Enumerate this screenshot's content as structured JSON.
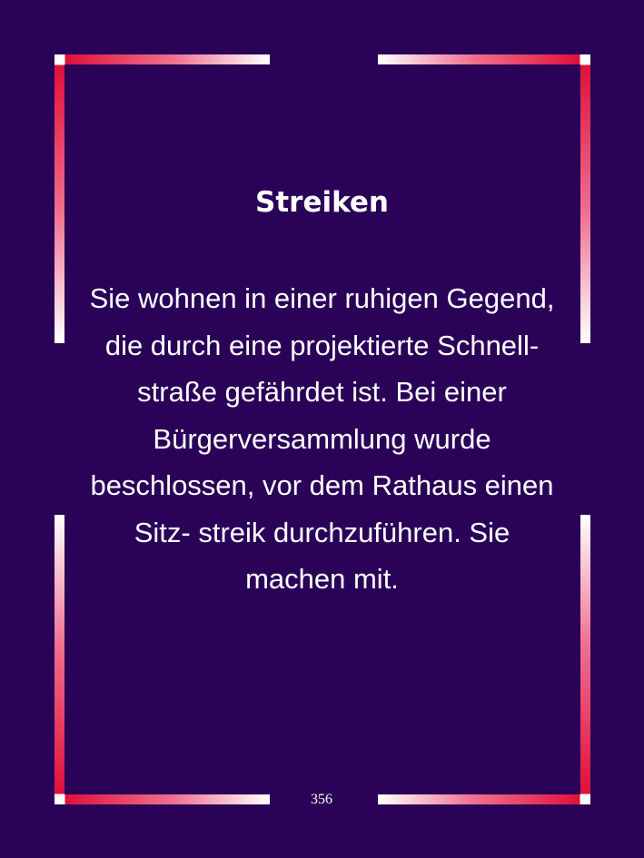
{
  "card": {
    "title": "Streiken",
    "body": "Sie wohnen in einer ruhigen Gegend, die durch eine projektierte Schnell- straße gefährdet ist. Bei einer Bürgerversammlung wurde beschlossen, vor dem Rathaus einen Sitz- streik durchzuführen. Sie machen mit.",
    "page_number": "356"
  },
  "colors": {
    "background": "#2a0358",
    "frame_accent": "#e0103a",
    "frame_light": "#ffffff",
    "text": "#ffffff"
  }
}
